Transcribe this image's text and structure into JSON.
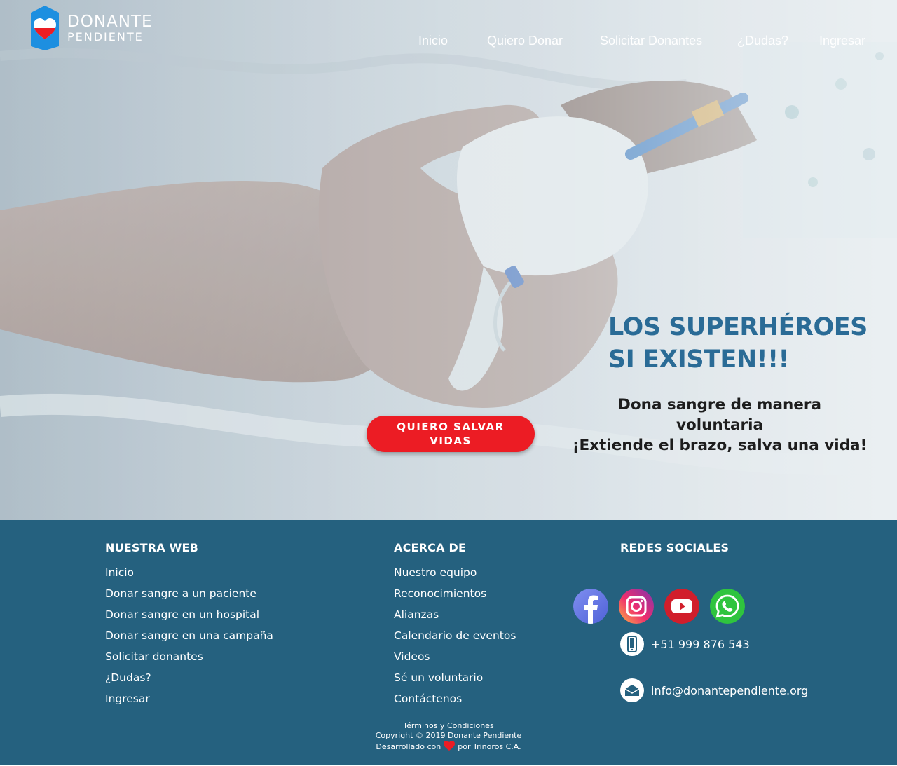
{
  "brand": {
    "line1": "DONANTE",
    "line2": "PENDIENTE",
    "color_blue": "#1d8fe0",
    "color_red": "#ec1c24"
  },
  "nav": {
    "items": [
      {
        "label": "Inicio"
      },
      {
        "label": "Quiero Donar"
      },
      {
        "label": "Solicitar Donantes"
      },
      {
        "label": "¿Dudas?"
      },
      {
        "label": "Ingresar"
      }
    ]
  },
  "hero": {
    "headline_line1": "LOS SUPERHÉROES",
    "headline_line2": "SI EXISTEN!!!",
    "sub_line1": "Dona sangre de manera",
    "sub_line2": "voluntaria",
    "sub_line3": "¡Extiende el brazo, salva una vida!",
    "cta_label": "QUIERO SALVAR VIDAS",
    "headline_color": "#2a6b96",
    "cta_color": "#ec1c24"
  },
  "footer": {
    "background": "#25617f",
    "web": {
      "title": "NUESTRA WEB",
      "links": [
        "Inicio",
        "Donar sangre a un paciente",
        "Donar sangre en un hospital",
        "Donar sangre en una campaña",
        "Solicitar donantes",
        "¿Dudas?",
        "Ingresar"
      ]
    },
    "about": {
      "title": "ACERCA DE",
      "links": [
        "Nuestro equipo",
        "Reconocimientos",
        "Alianzas",
        "Calendario de eventos",
        "Videos",
        "Sé un voluntario",
        "Contáctenos"
      ]
    },
    "social": {
      "title": "REDES SOCIALES",
      "networks": [
        "facebook-icon",
        "instagram-icon",
        "youtube-icon",
        "whatsapp-icon"
      ],
      "phone": "+51 999 876 543",
      "email": "info@donantependiente.org"
    },
    "legal": {
      "terms": "Términos y Condiciones",
      "copyright": "Copyright © 2019 Donante Pendiente",
      "made_prefix": "Desarrollado con",
      "made_suffix": "por Trinoros C.A."
    }
  }
}
